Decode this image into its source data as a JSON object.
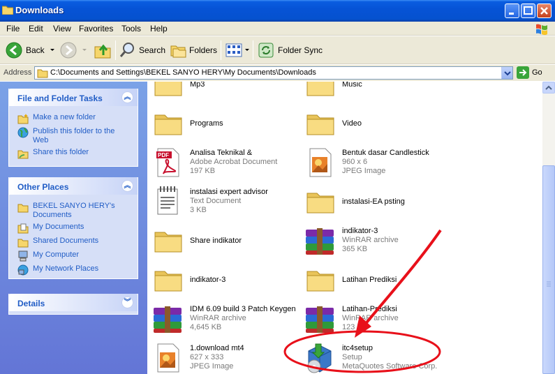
{
  "window": {
    "title": "Downloads"
  },
  "menu": [
    "File",
    "Edit",
    "View",
    "Favorites",
    "Tools",
    "Help"
  ],
  "toolbar": {
    "back": "Back",
    "search": "Search",
    "folders": "Folders",
    "folder_sync": "Folder Sync"
  },
  "address": {
    "label": "Address",
    "path": "C:\\Documents and Settings\\BEKEL SANYO HERY\\My Documents\\Downloads",
    "go": "Go"
  },
  "tasks_panel": {
    "title": "File and Folder Tasks",
    "items": [
      "Make a new folder",
      "Publish this folder to the Web",
      "Share this folder"
    ]
  },
  "places_panel": {
    "title": "Other Places",
    "items": [
      "BEKEL SANYO HERY's Documents",
      "My Documents",
      "Shared Documents",
      "My Computer",
      "My Network Places"
    ]
  },
  "details_panel": {
    "title": "Details"
  },
  "files": [
    {
      "name": "Mp3",
      "type": "",
      "size": "",
      "icon": "folder-icon"
    },
    {
      "name": "Music",
      "type": "",
      "size": "",
      "icon": "folder-icon"
    },
    {
      "name": "Programs",
      "type": "",
      "size": "",
      "icon": "folder-icon"
    },
    {
      "name": "Video",
      "type": "",
      "size": "",
      "icon": "folder-icon"
    },
    {
      "name": "Analisa Teknikal &",
      "type": "Adobe Acrobat Document",
      "size": "197 KB",
      "icon": "pdf-icon"
    },
    {
      "name": "Bentuk dasar Candlestick",
      "type": "960 x 6",
      "size": "JPEG Image",
      "icon": "jpeg-icon"
    },
    {
      "name": "instalasi expert advisor",
      "type": "Text Document",
      "size": "3 KB",
      "icon": "text-document-icon"
    },
    {
      "name": "instalasi-EA psting",
      "type": "",
      "size": "",
      "icon": "folder-icon"
    },
    {
      "name": "Share indikator",
      "type": "",
      "size": "",
      "icon": "folder-icon"
    },
    {
      "name": "indikator-3",
      "type": "WinRAR archive",
      "size": "365 KB",
      "icon": "winrar-icon"
    },
    {
      "name": "indikator-3",
      "type": "",
      "size": "",
      "icon": "folder-icon"
    },
    {
      "name": "Latihan Prediksi",
      "type": "",
      "size": "",
      "icon": "folder-icon"
    },
    {
      "name": "IDM 6.09 build 3 Patch Keygen",
      "type": "WinRAR archive",
      "size": "4,645 KB",
      "icon": "winrar-icon"
    },
    {
      "name": "Latihan-Prediksi",
      "type": "WinRAR archive",
      "size": "123 KB",
      "icon": "winrar-icon"
    },
    {
      "name": "1.download mt4",
      "type": "627 x 333",
      "size": "JPEG Image",
      "icon": "jpeg-icon"
    },
    {
      "name": "itc4setup",
      "type": "Setup",
      "size": "MetaQuotes Software Corp.",
      "icon": "setup-icon"
    }
  ],
  "colors": {
    "titlebar": "#0653d6",
    "annotation": "#e8101a",
    "link": "#215dc6"
  }
}
